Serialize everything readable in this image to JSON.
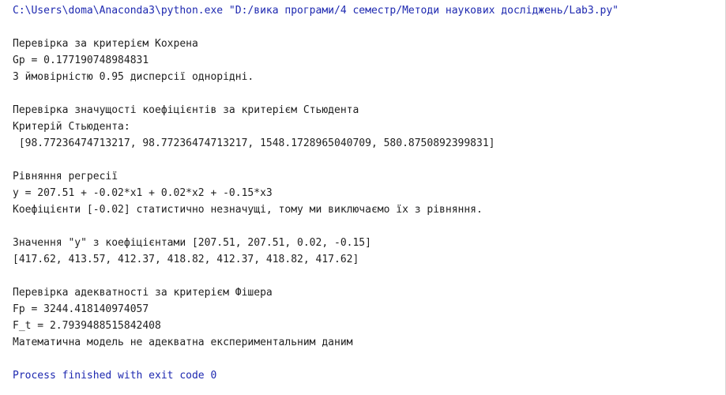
{
  "console": {
    "command": "C:\\Users\\doma\\Anaconda3\\python.exe \"D:/вика програми/4 семестр/Методи наукових досліджень/Lab3.py\"",
    "lines": [
      "",
      "Перевірка за критерієм Кохрена",
      "Gp = 0.177190748984831",
      "З ймовірністю 0.95 дисперсії однорідні.",
      "",
      "Перевірка значущості коефіцієнтів за критерієм Стьюдента",
      "Критерій Стьюдента:",
      " [98.77236474713217, 98.77236474713217, 1548.1728965040709, 580.8750892399831]",
      "",
      "Рівняння регресії",
      "y = 207.51 + -0.02*x1 + 0.02*x2 + -0.15*x3",
      "Коефіцієнти [-0.02] статистично незначущі, тому ми виключаємо їх з рівняння.",
      "",
      "Значення \"у\" з коефіцієнтами [207.51, 207.51, 0.02, -0.15]",
      "[417.62, 413.57, 412.37, 418.82, 412.37, 418.82, 417.62]",
      "",
      "Перевірка адекватності за критерієм Фішера",
      "Fp = 3244.418140974057",
      "F_t = 2.7939488515842408",
      "Математична модель не адекватна експериментальним даним",
      ""
    ],
    "exit_message": "Process finished with exit code 0"
  },
  "colors": {
    "command_text": "#1d28b0",
    "output_text": "#1f1f1f",
    "background": "#ffffff"
  }
}
